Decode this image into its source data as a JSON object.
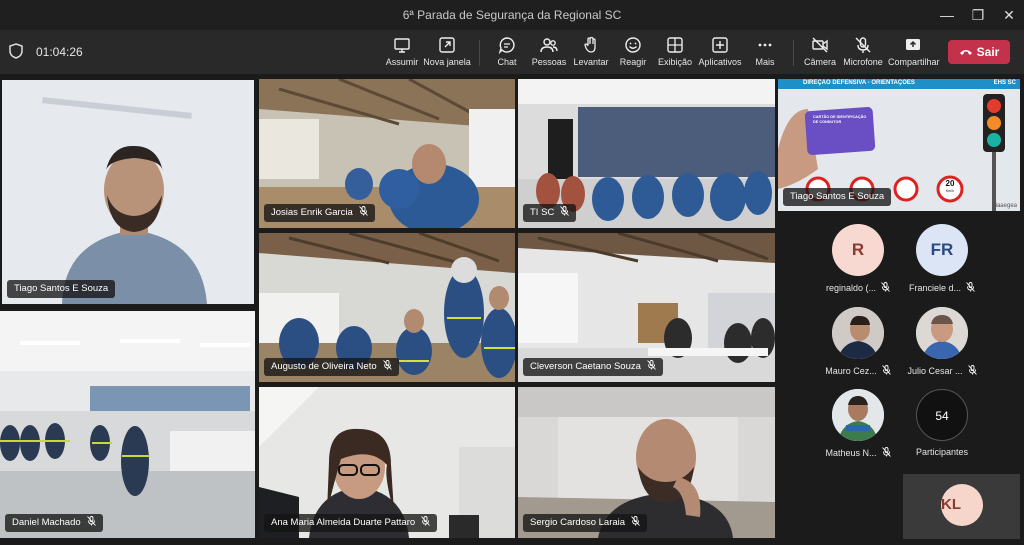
{
  "window": {
    "title": "6ª Parada de Segurança da Regional SC",
    "controls": [
      "—",
      "❐",
      "✕"
    ]
  },
  "toolbar": {
    "timer": "01:04:26",
    "buttons": {
      "share": "Assumir",
      "new_window": "Nova janela",
      "chat": "Chat",
      "people": "Pessoas",
      "raise": "Levantar",
      "react": "Reagir",
      "view": "Exibição",
      "apps": "Aplicativos",
      "more": "Mais",
      "camera": "Câmera",
      "mic": "Microfone",
      "share_screen": "Compartilhar"
    },
    "leave_label": "Sair",
    "leave_color": "#c4314b"
  },
  "tiles": {
    "t1": "Tiago Santos E Souza",
    "t2": "Josias Enrik Garcia",
    "t3": "TI SC",
    "t4": "Tiago Santos E Souza",
    "t5": "Augusto de Oliveira Neto",
    "t6": "Cleverson Caetano Souza",
    "t7": "Daniel Machado",
    "t8": "Ana Maria Almeida Duarte Pattaro",
    "t9": "Sergio Cardoso Laraia"
  },
  "presentation": {
    "header": "DIREÇÃO DEFENSIVA - ORIENTAÇÕES",
    "header_right": "EHS SC",
    "card_text": "CARTÃO DE IDENTIFICAÇÃO DE CONDUTOR",
    "speed_sign": "20",
    "speed_unit": "Km/h",
    "logo": "ciaaegea"
  },
  "participants": [
    {
      "initials": "R",
      "name": "reginaldo (..."
    },
    {
      "initials": "FR",
      "name": "Franciele d..."
    },
    {
      "initials": "",
      "name": "Mauro Cez..."
    },
    {
      "initials": "",
      "name": "Julio Cesar ..."
    },
    {
      "initials": "",
      "name": "Matheus N..."
    }
  ],
  "participants_count": {
    "number": "54",
    "label": "Participantes"
  },
  "self_view": {
    "initials": "KL"
  },
  "accent_color": "#7f85f5"
}
